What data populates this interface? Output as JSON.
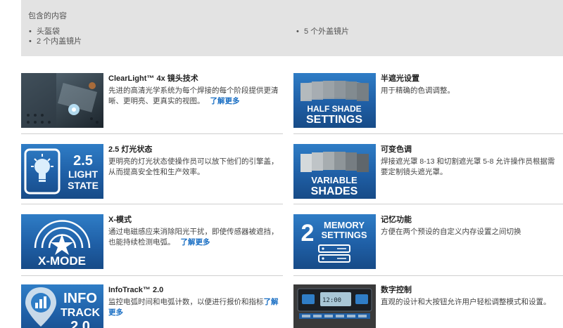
{
  "contents": {
    "title": "包含的内容",
    "left_items": [
      "头盔袋",
      "2 个内盖镜片"
    ],
    "right_items": [
      "5 个外盖镜片"
    ]
  },
  "features": [
    {
      "title": "ClearLight™ 4x 镜头技术",
      "desc": "先进的高清光学系统为每个焊接的每个阶段提供更清晰、更明亮、更真实的视图。",
      "link": "了解更多",
      "badge": ""
    },
    {
      "title": "半遮光设置",
      "desc": "用于精确的色调调整。",
      "link": "",
      "badge_lines": [
        "HALF SHADE",
        "SETTINGS"
      ]
    },
    {
      "title": "2.5 灯光状态",
      "desc": "更明亮的灯光状态使操作员可以放下他们的引擎盖，从而提高安全性和生产效率。",
      "link": "",
      "badge_lines": [
        "2.5",
        "LIGHT",
        "STATE"
      ]
    },
    {
      "title": "可变色调",
      "desc": "焊接遮光罩 8-13 和切割遮光罩 5-8 允许操作员根据需要定制镜头遮光罩。",
      "link": "",
      "badge_lines": [
        "VARIABLE",
        "SHADES"
      ]
    },
    {
      "title": "X-模式",
      "desc": "通过电磁感应来消除阳光干扰，即使传感器被遮挡，也能持续检测电弧。",
      "link": "了解更多",
      "badge_lines": [
        "X-MODE"
      ]
    },
    {
      "title": "记忆功能",
      "desc": "方便在两个预设的自定义内存设置之间切换",
      "link": "",
      "badge_lines": [
        "2",
        "MEMORY",
        "SETTINGS"
      ]
    },
    {
      "title": "InfoTrack™ 2.0",
      "desc": "监控电弧时间和电弧计数，以便进行报价和指标",
      "link": "了解更多",
      "badge_lines": [
        "INFO",
        "TRACK",
        "2.0"
      ]
    },
    {
      "title": "数字控制",
      "desc": "直观的设计和大按钮允许用户轻松调整模式和设置。",
      "link": "",
      "badge_lines": []
    }
  ]
}
